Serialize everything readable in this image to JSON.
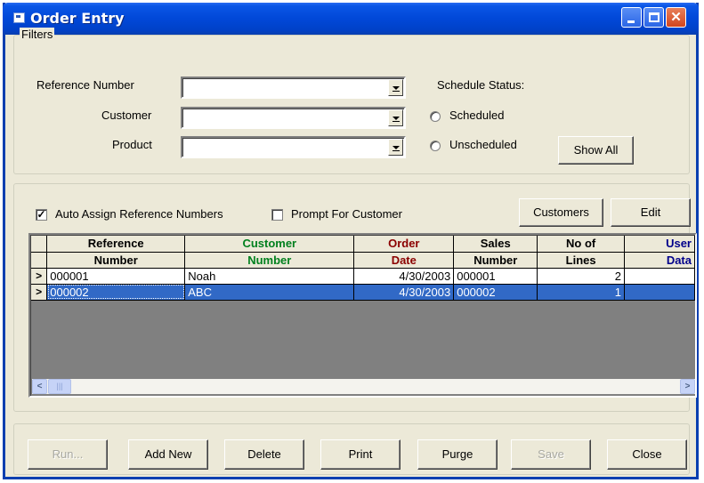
{
  "window": {
    "title": "Order Entry"
  },
  "filters": {
    "group_label": "Filters",
    "reference_label": "Reference Number",
    "reference_value": "",
    "customer_label": "Customer",
    "customer_value": "",
    "product_label": "Product",
    "product_value": "",
    "schedule_status_label": "Schedule Status:",
    "scheduled_label": "Scheduled",
    "unscheduled_label": "Unscheduled",
    "show_all_label": "Show All"
  },
  "options": {
    "auto_assign_label": "Auto Assign Reference Numbers",
    "auto_assign_checked": true,
    "prompt_customer_label": "Prompt For Customer",
    "prompt_customer_checked": false,
    "customers_button": "Customers",
    "edit_button": "Edit"
  },
  "grid": {
    "columns": [
      {
        "line1": "Reference",
        "line2": "Number",
        "color": "#000000"
      },
      {
        "line1": "Customer",
        "line2": "Number",
        "color": "#00801e"
      },
      {
        "line1": "Order",
        "line2": "Date",
        "color": "#8b0000"
      },
      {
        "line1": "Sales",
        "line2": "Number",
        "color": "#000000"
      },
      {
        "line1": "No of",
        "line2": "Lines",
        "color": "#000000"
      },
      {
        "line1": "User",
        "line2": "Data",
        "color": "#00008b"
      }
    ],
    "rows": [
      {
        "marker": ">",
        "reference": "000001",
        "customer": "Noah",
        "order_date": "4/30/2003",
        "sales": "000001",
        "lines": "2",
        "user": ""
      },
      {
        "marker": ">",
        "reference": "000002",
        "customer": "ABC",
        "order_date": "4/30/2003",
        "sales": "000002",
        "lines": "1",
        "user": ""
      }
    ],
    "scroll_left": "<",
    "scroll_right": ">",
    "scroll_thumb": "|||"
  },
  "buttons": {
    "run": "Run...",
    "add_new": "Add New",
    "delete": "Delete",
    "print": "Print",
    "purge": "Purge",
    "save": "Save",
    "close": "Close"
  }
}
